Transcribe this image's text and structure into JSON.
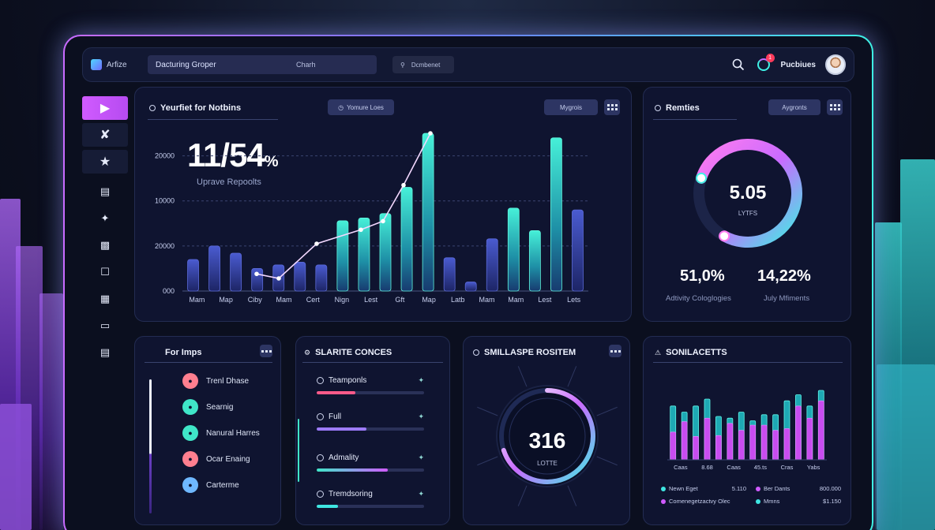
{
  "topbar": {
    "brand": "Arfize",
    "search_value": "Dacturing Groper",
    "search_center": "Charh",
    "dash_label": "Dcmbenet",
    "notification_count": "1",
    "profile_name": "Pucbiues"
  },
  "sidebar": {
    "items": [
      {
        "icon": "play-icon"
      },
      {
        "icon": "tools-icon"
      },
      {
        "icon": "star-icon"
      },
      {
        "icon": "document-icon"
      },
      {
        "icon": "sparkle-icon"
      },
      {
        "icon": "camera-icon"
      },
      {
        "icon": "clipboard-icon"
      },
      {
        "icon": "calendar-icon"
      },
      {
        "icon": "monitor-icon"
      },
      {
        "icon": "display-icon"
      }
    ]
  },
  "main_panel": {
    "title": "Yeurfiet for Notbins",
    "chip": "Yomure Loes",
    "tab": "Mygrois",
    "big_value": "11/54",
    "big_unit": "%",
    "big_sub": "Uprave Repoolts"
  },
  "chart_data": {
    "type": "bar",
    "categories": [
      "Mam",
      "Map",
      "Ciby",
      "Mam",
      "Cert",
      "Nign",
      "Lest",
      "Gft",
      "Map",
      "Latb",
      "Mam",
      "Mam",
      "Lest",
      "Lets"
    ],
    "yticks": [
      "000",
      "20000",
      "10000",
      "20000"
    ],
    "ytick_positions": [
      0,
      10000,
      20000,
      30000
    ],
    "ylim": [
      0,
      35000
    ],
    "bars": [
      {
        "value": 7000,
        "color": "blue"
      },
      {
        "value": 10000,
        "color": "blue"
      },
      {
        "value": 8400,
        "color": "blue"
      },
      {
        "value": 5000,
        "color": "blue"
      },
      {
        "value": 5800,
        "color": "blue"
      },
      {
        "value": 6400,
        "color": "blue"
      },
      {
        "value": 5800,
        "color": "blue"
      },
      {
        "value": 15600,
        "color": "teal"
      },
      {
        "value": 16200,
        "color": "teal"
      },
      {
        "value": 17200,
        "color": "teal"
      },
      {
        "value": 23000,
        "color": "teal"
      },
      {
        "value": 35000,
        "color": "teal"
      },
      {
        "value": 7400,
        "color": "blue"
      },
      {
        "value": 2000,
        "color": "blue"
      },
      {
        "value": 11600,
        "color": "blue"
      },
      {
        "value": 18400,
        "color": "teal"
      },
      {
        "value": 13400,
        "color": "teal"
      },
      {
        "value": 34000,
        "color": "teal"
      },
      {
        "value": 18000,
        "color": "blue"
      }
    ],
    "line": [
      3800,
      2800,
      10500,
      13600,
      15500,
      23500,
      35000
    ],
    "ylabel": "",
    "xlabel": ""
  },
  "right_panel": {
    "title": "Remties",
    "chip": "Aygronts",
    "ring_value": "5.05",
    "ring_label": "LYTFS",
    "ring_fraction": 0.78,
    "stat1_value": "51,0%",
    "stat1_label": "Adtivity Cologlogies",
    "stat2_value": "14,22%",
    "stat2_label": "July Mfiments"
  },
  "panel_impacts": {
    "title": "For Imps",
    "items": [
      {
        "label": "Trenl Dhase",
        "color": "#ff7f8f"
      },
      {
        "label": "Searnig",
        "color": "#3fe6c8"
      },
      {
        "label": "Nanural Harres",
        "color": "#3fe6c8"
      },
      {
        "label": "Ocar Enaing",
        "color": "#ff7f8f"
      },
      {
        "label": "Carterme",
        "color": "#6fb8ff"
      }
    ]
  },
  "panel_conces": {
    "title": "SLARITE CONCES",
    "items": [
      {
        "label": "Teamponls",
        "progress": 0.36,
        "color": "#ff5a8a"
      },
      {
        "label": "Full",
        "progress": 0.46,
        "color": "#9d7bff"
      },
      {
        "label": "Admality",
        "progress": 0.66,
        "color": "#3fe6c8",
        "color2": "#d05bff"
      },
      {
        "label": "Tremdsoring",
        "progress": 0.2,
        "color": "#3fe6e2"
      }
    ]
  },
  "panel_system": {
    "title": "SMILLASPE ROSITEM",
    "gauge_value": "316",
    "gauge_label": "LOTTE",
    "gauge_fraction": 0.7
  },
  "panel_results": {
    "title": "SONILACETTS",
    "x_labels": [
      "Caas",
      "8.68",
      "Caas",
      "45.ts",
      "Cras",
      "Yabs"
    ],
    "bars": [
      {
        "teal": 0.62,
        "pink": 0.32
      },
      {
        "teal": 0.55,
        "pink": 0.44
      },
      {
        "teal": 0.62,
        "pink": 0.27
      },
      {
        "teal": 0.7,
        "pink": 0.48
      },
      {
        "teal": 0.5,
        "pink": 0.28
      },
      {
        "teal": 0.48,
        "pink": 0.42
      },
      {
        "teal": 0.55,
        "pink": 0.34
      },
      {
        "teal": 0.45,
        "pink": 0.4
      },
      {
        "teal": 0.52,
        "pink": 0.4
      },
      {
        "teal": 0.52,
        "pink": 0.34
      },
      {
        "teal": 0.68,
        "pink": 0.36
      },
      {
        "teal": 0.75,
        "pink": 0.62
      },
      {
        "teal": 0.62,
        "pink": 0.48
      },
      {
        "teal": 0.8,
        "pink": 0.68
      }
    ],
    "legend": [
      {
        "label": "Newn Eget",
        "value": "5.110",
        "color": "#3fe6e2"
      },
      {
        "label": "Ber Dants",
        "value": "800.000",
        "color": "#d05bff"
      },
      {
        "label": "Comenegetzactvy Olec",
        "value": "",
        "color": "#d05bff"
      },
      {
        "label": "Mmns",
        "value": "$1.150",
        "color": "#3fe6e2"
      }
    ]
  }
}
